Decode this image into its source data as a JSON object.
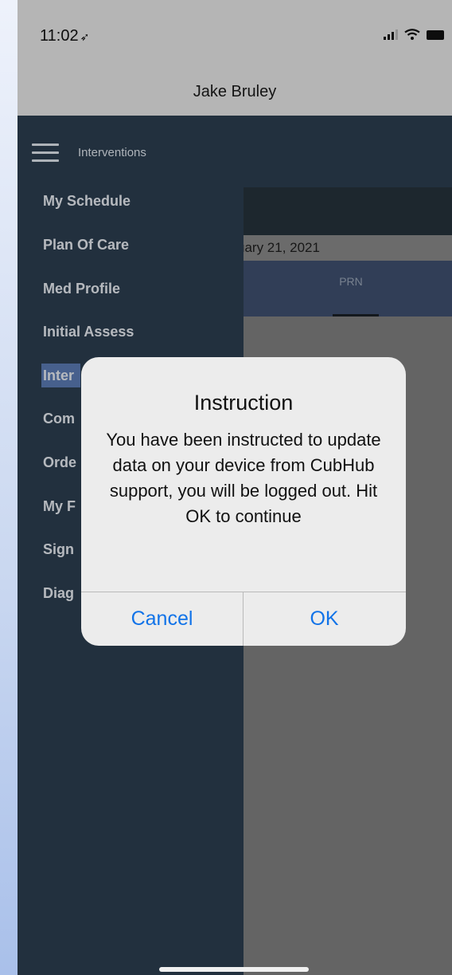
{
  "status_bar": {
    "time": "11:02",
    "location_arrow": "➶"
  },
  "nav": {
    "title": "Jake Bruley"
  },
  "header": {
    "title": "Interventions"
  },
  "content": {
    "date_text": "uary 21, 2021",
    "tab_label": "PRN"
  },
  "sidebar": {
    "items": [
      {
        "label": "My Schedule"
      },
      {
        "label": "Plan Of Care"
      },
      {
        "label": "Med Profile"
      },
      {
        "label": "Initial Assess"
      },
      {
        "label": "Inter"
      },
      {
        "label": "Com"
      },
      {
        "label": "Orde"
      },
      {
        "label": "My F"
      },
      {
        "label": "Sign"
      },
      {
        "label": "Diag"
      }
    ]
  },
  "alert": {
    "title": "Instruction",
    "message": "You have been instructed to update data on your device from CubHub support, you will be logged out. Hit OK to continue",
    "cancel_label": "Cancel",
    "ok_label": "OK"
  },
  "colors": {
    "sidebar_bg": "#2c3e50",
    "active_item": "#5b7bb5",
    "alert_button": "#1173e8",
    "tab_bar": "#3f5070"
  }
}
